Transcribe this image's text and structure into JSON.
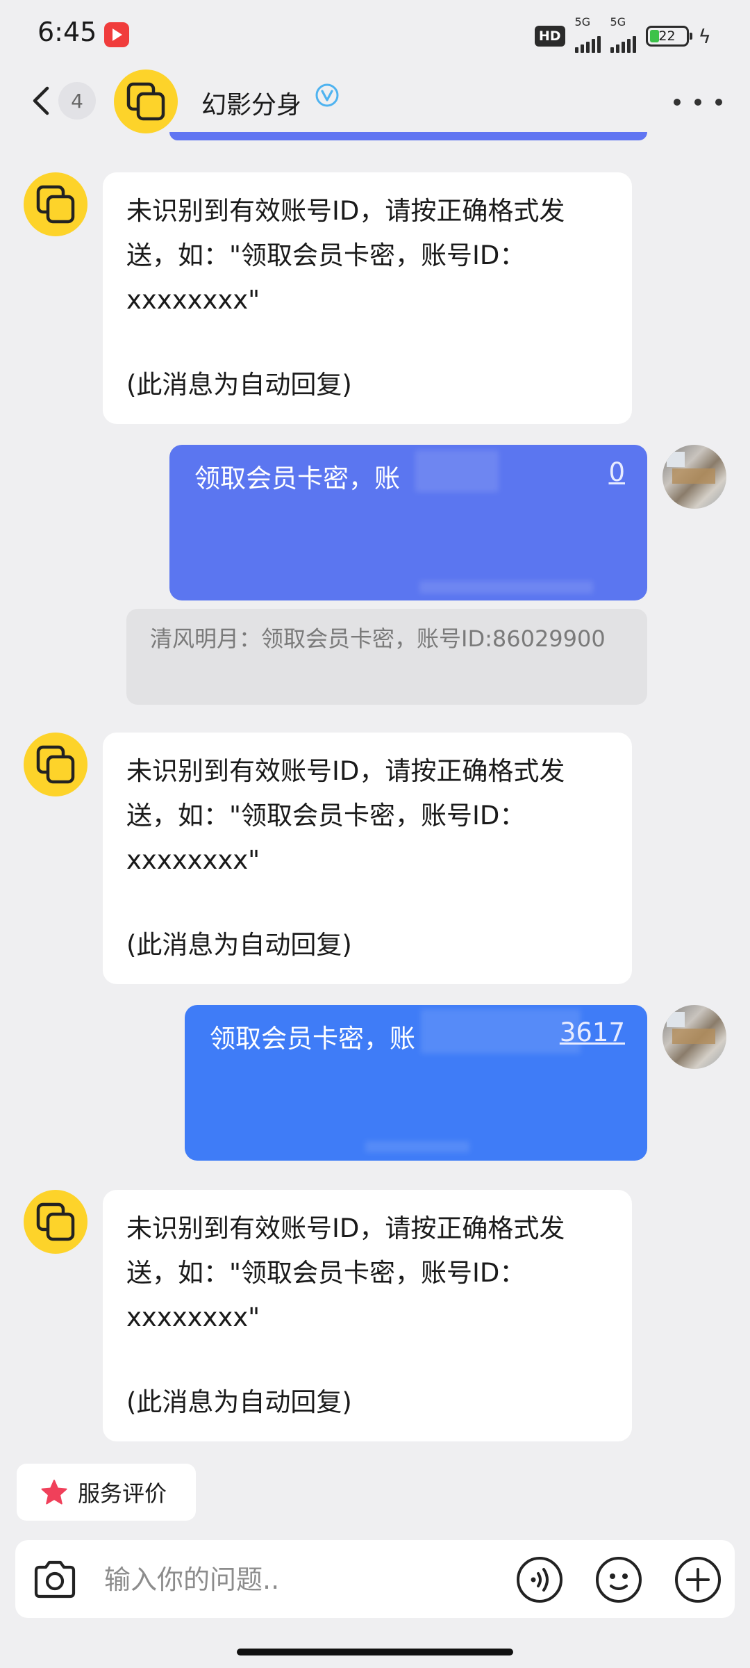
{
  "status_bar": {
    "time": "6:45",
    "hd_label": "HD",
    "network_1": "5G",
    "network_2": "5G",
    "battery": "22"
  },
  "header": {
    "back_count": "4",
    "title": "幻影分身",
    "verified_icon": "verified-v-icon",
    "accent_color": "#fdd32a"
  },
  "messages": {
    "bot_reply": {
      "line1": "未识别到有效账号ID，请按正确格式发",
      "line2": "送，如：\"领取会员卡密，账号ID：",
      "line3": "xxxxxxxx\"",
      "line4": "(此消息为自动回复)"
    },
    "user_1": {
      "text": "领取会员卡密，账",
      "tail": "0",
      "color": "#5b76f0"
    },
    "quote": {
      "text": "清风明月：领取会员卡密，账号ID:86029900"
    },
    "user_2": {
      "text": "领取会员卡密，账",
      "tail": "3617",
      "color": "#3f7cf7"
    }
  },
  "rating": {
    "label": "服务评价",
    "icon": "star-icon",
    "icon_color": "#f0405a"
  },
  "input_bar": {
    "placeholder": "输入你的问题.."
  }
}
